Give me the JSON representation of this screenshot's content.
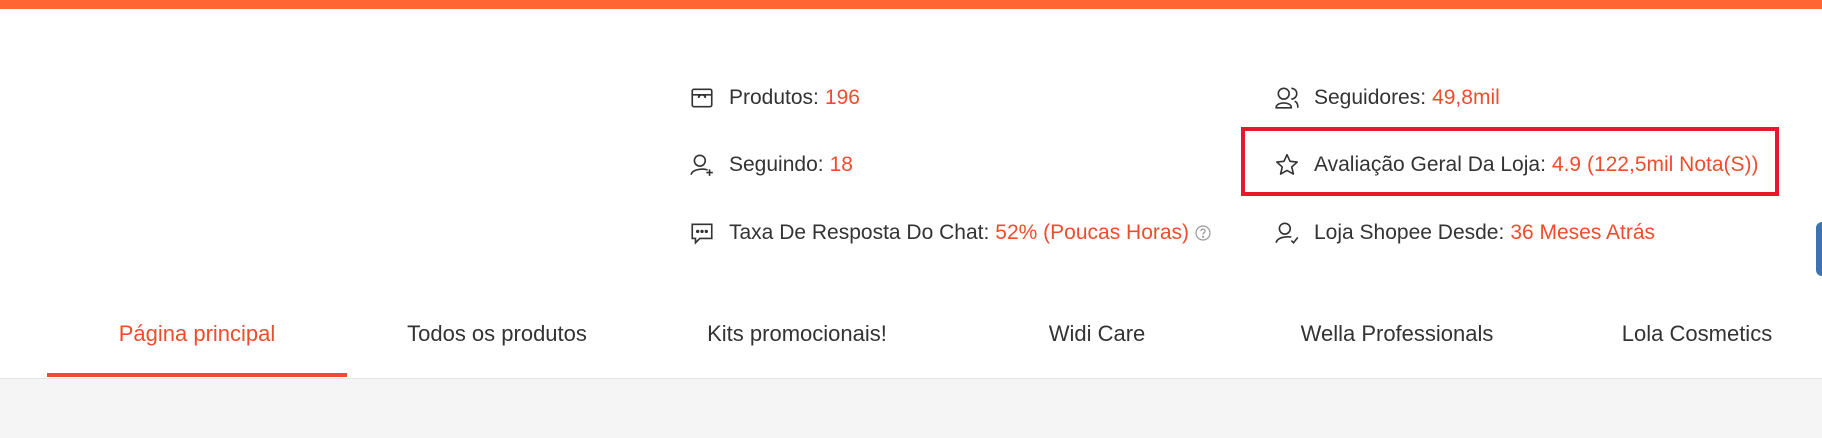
{
  "colors": {
    "accent": "#ee4d2d",
    "top_bar": "#ff6633",
    "highlight": "#e8182b"
  },
  "stats": {
    "products": {
      "label": "Produtos:",
      "value": "196",
      "icon": "store-icon"
    },
    "followers": {
      "label": "Seguidores:",
      "value": "49,8mil",
      "icon": "followers-icon"
    },
    "following": {
      "label": "Seguindo:",
      "value": "18",
      "icon": "user-add-icon"
    },
    "rating": {
      "label": "Avaliação Geral Da Loja:",
      "value": "4.9 (122,5mil Nota(S))",
      "icon": "star-icon"
    },
    "chat": {
      "label": "Taxa De Resposta Do Chat:",
      "value": "52% (Poucas Horas)",
      "icon": "chat-icon"
    },
    "joined": {
      "label": "Loja Shopee Desde:",
      "value": "36 Meses Atrás",
      "icon": "user-check-icon"
    }
  },
  "tabs": [
    {
      "label": "Página principal",
      "active": true
    },
    {
      "label": "Todos os produtos",
      "active": false
    },
    {
      "label": "Kits promocionais!",
      "active": false
    },
    {
      "label": "Widi Care",
      "active": false
    },
    {
      "label": "Wella Professionals",
      "active": false
    },
    {
      "label": "Lola Cosmetics",
      "active": false
    }
  ]
}
